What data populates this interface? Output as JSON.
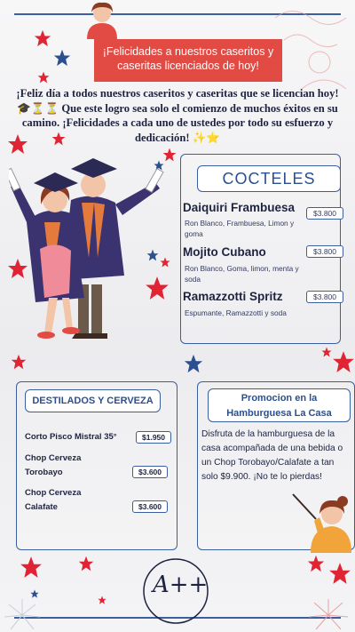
{
  "banner": {
    "text": "¡Felicidades a nuestros caseritos y caseritas licenciados de hoy!"
  },
  "intro": {
    "text": "¡Feliz día a todos nuestros caseritos y caseritas que se licencian hoy! 🎓⏳⏳ Que este logro sea solo el comienzo de muchos éxitos en su camino. ¡Felicidades a cada uno de ustedes por todo su esfuerzo y dedicación! ✨⭐"
  },
  "cocteles": {
    "title": "COCTELES",
    "items": [
      {
        "name": "Daiquiri Frambuesa",
        "desc": "Ron Blanco, Frambuesa, Limon y goma",
        "price": "$3.800"
      },
      {
        "name": "Mojito Cubano",
        "desc": "Ron Blanco, Goma, limon, menta y soda",
        "price": "$3.800"
      },
      {
        "name": "Ramazzotti Spritz",
        "desc": "Espumante, Ramazzotti y soda",
        "price": "$3.800"
      }
    ]
  },
  "destilados": {
    "title": "DESTILADOS Y CERVEZA",
    "items": [
      {
        "name": "Corto Pisco Mistral 35°",
        "price": "$1.950"
      },
      {
        "name": "Chop Cerveza Torobayo",
        "price": "$3.600"
      },
      {
        "name": "Chop Cerveza Calafate",
        "price": "$3.600"
      }
    ]
  },
  "promo": {
    "title": "Promocion en la Hamburguesa La Casa",
    "text": "Disfruta de la hamburguesa de la casa acompañada de una bebida o un Chop Torobayo/Calafate  a tan solo $9.900. ¡No te lo pierdas!"
  },
  "badge": {
    "text": "A++"
  },
  "colors": {
    "accent_red": "#e24a44",
    "navy": "#2b4f8f",
    "star_red": "#e02434",
    "star_blue": "#2b4f8f"
  }
}
